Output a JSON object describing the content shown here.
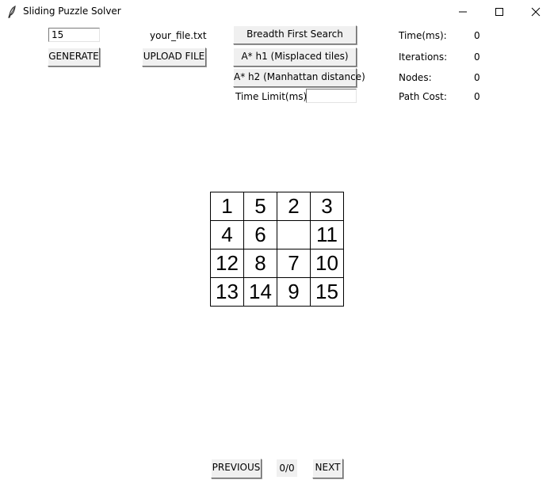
{
  "window": {
    "title": "Sliding Puzzle Solver"
  },
  "controls": {
    "size_value": "15",
    "file_name": "your_file.txt",
    "generate_label": "GENERATE",
    "upload_label": "UPLOAD FILE",
    "bfs_label": "Breadth First Search",
    "astar_h1_label": "A* h1 (Misplaced tiles)",
    "astar_h2_label": "A* h2 (Manhattan distance)",
    "time_limit_label": "Time Limit(ms):",
    "time_limit_value": ""
  },
  "stats": [
    {
      "label": "Time(ms):",
      "value": "0"
    },
    {
      "label": "Iterations:",
      "value": "0"
    },
    {
      "label": "Nodes:",
      "value": "0"
    },
    {
      "label": "Path Cost:",
      "value": "0"
    }
  ],
  "board": [
    "1",
    "5",
    "2",
    "3",
    "4",
    "6",
    "",
    "11",
    "12",
    "8",
    "7",
    "10",
    "13",
    "14",
    "9",
    "15"
  ],
  "navigation": {
    "previous_label": "PREVIOUS",
    "counter": "0/0",
    "next_label": "NEXT"
  }
}
